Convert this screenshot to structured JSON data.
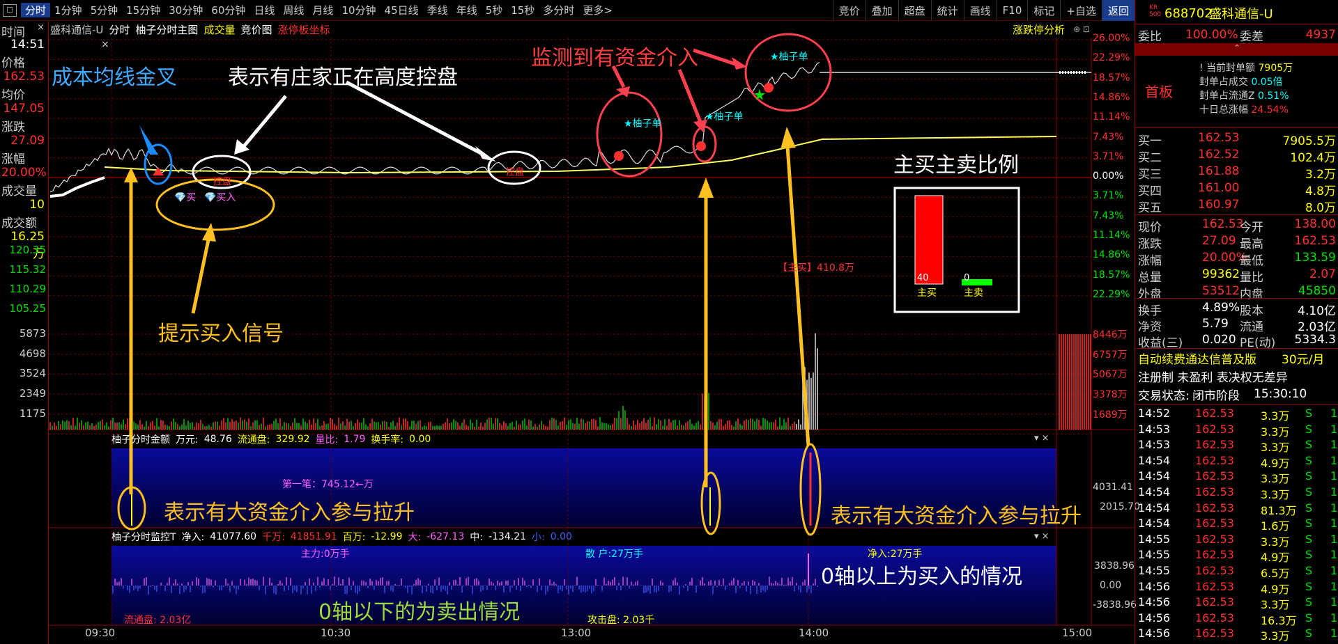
{
  "periods": [
    "分时",
    "1分钟",
    "5分钟",
    "15分钟",
    "30分钟",
    "60分钟",
    "日线",
    "周线",
    "月线",
    "10分钟",
    "45日线",
    "季线",
    "年线",
    "5秒",
    "15秒",
    "多分时",
    "更多>"
  ],
  "toolbar": [
    "竞价",
    "叠加",
    "超盘",
    "统计",
    "画线",
    "F10",
    "标记",
    "+自选",
    "返回"
  ],
  "sidebar": {
    "time_lbl": "时间",
    "time_val": "14:51",
    "price_lbl": "价格",
    "price_val": "162.53",
    "avg_lbl": "均价",
    "avg_val": "147.05",
    "chg_lbl": "涨跌",
    "chg_val": "27.09",
    "pct_lbl": "涨幅",
    "pct_val": "20.00%",
    "vol_lbl": "成交量",
    "vol_val": "10",
    "amt_lbl": "成交额",
    "amt_val": "16.25万"
  },
  "chart_title": {
    "name": "盛科通信-U",
    "t1": "分时",
    "t2": "柚子分时主图",
    "t3": "成交量",
    "t4": "竞价图",
    "t5": "涨停板坐标",
    "right": "涨跌停分析"
  },
  "price_axis": {
    "left": [
      "120.35",
      "115.32",
      "110.29",
      "105.25"
    ],
    "right": [
      "26.00%",
      "22.29%",
      "18.57%",
      "14.86%",
      "11.14%",
      "7.43%",
      "3.71%",
      "0.00%",
      "3.71%",
      "7.43%",
      "11.14%",
      "14.86%",
      "18.57%",
      "22.29%"
    ]
  },
  "vol_axis": {
    "left": [
      "5873",
      "4698",
      "3524",
      "2349",
      "1175"
    ],
    "right": [
      "8446万",
      "6757万",
      "5067万",
      "3378万",
      "1689万"
    ]
  },
  "panel1": {
    "title": "柚子分时金额",
    "unit": "万元:",
    "v1": "48.76",
    "l2": "流通盘:",
    "v2": "329.92",
    "l3": "量比:",
    "v3": "1.79",
    "l4": "换手率:",
    "v4": "0.00",
    "first": "第一笔：745.12←万",
    "r1": "4031.41",
    "r2": "2015.70"
  },
  "panel2": {
    "title": "柚子分时监控T",
    "l1": "净入:",
    "v1": "41077.60",
    "l2": "千万:",
    "v2": "41851.91",
    "l3": "百万:",
    "v3": "-12.99",
    "l4": "大:",
    "v4": "-627.13",
    "l5": "中:",
    "v5": "-134.21",
    "l6": "小:",
    "v6": "0.00",
    "main": "主力:0万手",
    "retail": "散 户:27万手",
    "net": "净入:27万手",
    "float": "流通盘: 2.03亿",
    "attack": "攻击盘: 2.03千",
    "r1": "3838.96",
    "r2": "0.00",
    "r3": "-3838.96"
  },
  "xaxis": [
    "09:30",
    "10:30",
    "13:00",
    "14:00",
    "15:00"
  ],
  "chart_labels": {
    "yz1": "★柚子单",
    "yz2": "★柚子单",
    "yz3": "★柚子单",
    "buy1": "💎买",
    "buy2": "💎买入",
    "ctrl": "控盘",
    "ctrl2": "控盘",
    "zm": "【主买】410.8万",
    "zm_buy": "主买",
    "zm_sell": "主卖",
    "zm_v1": "40",
    "zm_v2": "0"
  },
  "annotations": {
    "a1": "成本均线金叉",
    "a2": "表示有庄家正在高度控盘",
    "a3": "监测到有资金介入",
    "a4": "提示买入信号",
    "a5": "主买主卖比例",
    "a6": "表示有大资金介入参与拉升",
    "a7": "表示有大资金介入参与拉升",
    "a8": "0轴以上为买入的情况",
    "a9": "0轴以下的为卖出情况"
  },
  "quote": {
    "kr": "KR",
    "kr2": "500",
    "code": "688702",
    "name": "盛科通信-U",
    "wb_l": "委比",
    "wb_v": "100.00%",
    "wc_l": "委差",
    "wc_v": "4937",
    "seal1_l": "当前封单额",
    "seal1_v": "7905万",
    "seal2_l": "封单占成交",
    "seal2_v": "0.05倍",
    "seal3_l": "封单占流通Z",
    "seal3_v": "0.51%",
    "seal4_l": "十日总涨幅",
    "seal4_v": "24.54%",
    "first_board": "首板",
    "bids": [
      {
        "l": "买一",
        "p": "162.53",
        "v": "7905.5万"
      },
      {
        "l": "买二",
        "p": "162.52",
        "v": "102.4万"
      },
      {
        "l": "买三",
        "p": "161.88",
        "v": "3.2万"
      },
      {
        "l": "买四",
        "p": "161.00",
        "v": "4.8万"
      },
      {
        "l": "买五",
        "p": "160.97",
        "v": "8.0万"
      }
    ],
    "stats": [
      {
        "l1": "现价",
        "v1": "162.53",
        "l2": "今开",
        "v2": "138.00"
      },
      {
        "l1": "涨跌",
        "v1": "27.09",
        "l2": "最高",
        "v2": "162.53"
      },
      {
        "l1": "涨幅",
        "v1": "20.00%",
        "l2": "最低",
        "v2": "133.59"
      },
      {
        "l1": "总量",
        "v1": "99362",
        "l2": "量比",
        "v2": "2.07"
      },
      {
        "l1": "外盘",
        "v1": "53512",
        "l2": "内盘",
        "v2": "45850"
      }
    ],
    "stats2": [
      {
        "l1": "换手",
        "v1": "4.89%",
        "l2": "股本",
        "v2": "4.10亿"
      },
      {
        "l1": "净资",
        "v1": "5.79",
        "l2": "流通",
        "v2": "2.03亿"
      },
      {
        "l1": "收益(三)",
        "v1": "0.020",
        "l2": "PE(动)",
        "v2": "5334.3"
      }
    ],
    "promo1": "自动续费通达信普及版",
    "promo1b": "30元/月",
    "promo2": "注册制 未盈利 表决权无差异",
    "status_l": "交易状态:",
    "status_v": "闭市阶段",
    "status_t": "15:30:10",
    "ticks": [
      [
        "14:52",
        "162.53",
        "3.3万",
        "S",
        "1"
      ],
      [
        "14:53",
        "162.53",
        "3.3万",
        "S",
        "1"
      ],
      [
        "14:53",
        "162.53",
        "3.3万",
        "S",
        "1"
      ],
      [
        "14:54",
        "162.53",
        "4.9万",
        "S",
        "1"
      ],
      [
        "14:54",
        "162.53",
        "3.3万",
        "S",
        "1"
      ],
      [
        "14:54",
        "162.53",
        "3.3万",
        "S",
        "1"
      ],
      [
        "14:54",
        "162.53",
        "81.3万",
        "S",
        "1"
      ],
      [
        "14:54",
        "162.53",
        "1.6万",
        "S",
        "1"
      ],
      [
        "14:55",
        "162.53",
        "3.3万",
        "S",
        "1"
      ],
      [
        "14:55",
        "162.53",
        "4.9万",
        "S",
        "1"
      ],
      [
        "14:55",
        "162.53",
        "6.5万",
        "S",
        "1"
      ],
      [
        "14:56",
        "162.53",
        "4.9万",
        "S",
        "1"
      ],
      [
        "14:56",
        "162.53",
        "3.3万",
        "S",
        "1"
      ],
      [
        "14:56",
        "162.53",
        "16.3万",
        "S",
        "1"
      ],
      [
        "14:56",
        "162.53",
        "3.3万",
        "S",
        "1"
      ]
    ]
  },
  "colors": {
    "up": "#ff3030",
    "down": "#00e000",
    "yellow": "#ffff00",
    "cyan": "#00ffff",
    "orange": "#ffc020"
  }
}
